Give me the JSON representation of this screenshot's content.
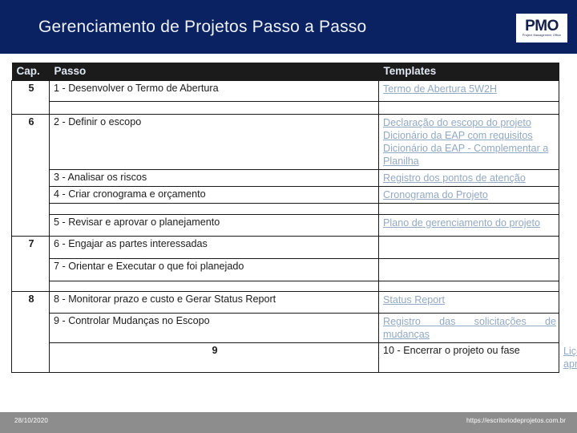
{
  "slide": {
    "title": "Gerenciamento de Projetos Passo a Passo",
    "logo": {
      "main": "PMO",
      "sub": "Project Management Office"
    }
  },
  "table": {
    "headers": {
      "cap": "Cap.",
      "passo": "Passo",
      "templates": "Templates"
    },
    "rows": [
      {
        "cap": "5",
        "cap_rowspan": 2,
        "passo": "1 - Desenvolver o Termo de Abertura",
        "templates": [
          "Termo de Abertura 5W2H"
        ]
      },
      {
        "cap": "",
        "passo": "",
        "templates": []
      },
      {
        "cap": "6",
        "cap_rowspan": 5,
        "passo": "2 - Definir o escopo",
        "templates": [
          "Declaração do escopo do projeto",
          "Dicionário da EAP com requisitos",
          "Dicionário da EAP - Complementar a Planilha"
        ]
      },
      {
        "cap": "",
        "passo": "3 - Analisar os riscos",
        "templates": [
          "Registro dos pontos de atenção"
        ]
      },
      {
        "cap": "",
        "passo": "4 - Criar cronograma e orçamento",
        "templates": [
          "Cronograma do Projeto"
        ]
      },
      {
        "cap": "",
        "passo": "",
        "templates": []
      },
      {
        "cap": "",
        "passo": "5 - Revisar e aprovar o planejamento",
        "templates": [
          "Plano de gerenciamento do projeto"
        ]
      },
      {
        "cap": "7",
        "cap_rowspan": 3,
        "passo": "6 - Engajar as partes interessadas",
        "templates": []
      },
      {
        "cap": "",
        "passo": "7 - Orientar e Executar o que foi planejado",
        "templates": []
      },
      {
        "cap": "",
        "passo": "",
        "templates": []
      },
      {
        "cap": "8",
        "cap_rowspan": 3,
        "passo": "8 - Monitorar prazo e custo e Gerar Status Report",
        "templates": [
          "Status Report"
        ]
      },
      {
        "cap": "",
        "passo": "9 - Controlar Mudanças no Escopo",
        "templates": [
          "Registro das solicitações de",
          "mudanças"
        ]
      },
      {
        "cap": "9",
        "cap_rowspan": 1,
        "passo": "10 - Encerrar o projeto ou fase",
        "templates": [
          "Lições aprendidas"
        ]
      }
    ]
  },
  "footer": {
    "date": "28/10/2020",
    "url": "https://escritoriodeprojetos.com.br"
  },
  "colors": {
    "banner": "#0b2262",
    "header_row": "#1b1b1b",
    "link": "#92a9c4",
    "footer": "#8d8d8d"
  }
}
